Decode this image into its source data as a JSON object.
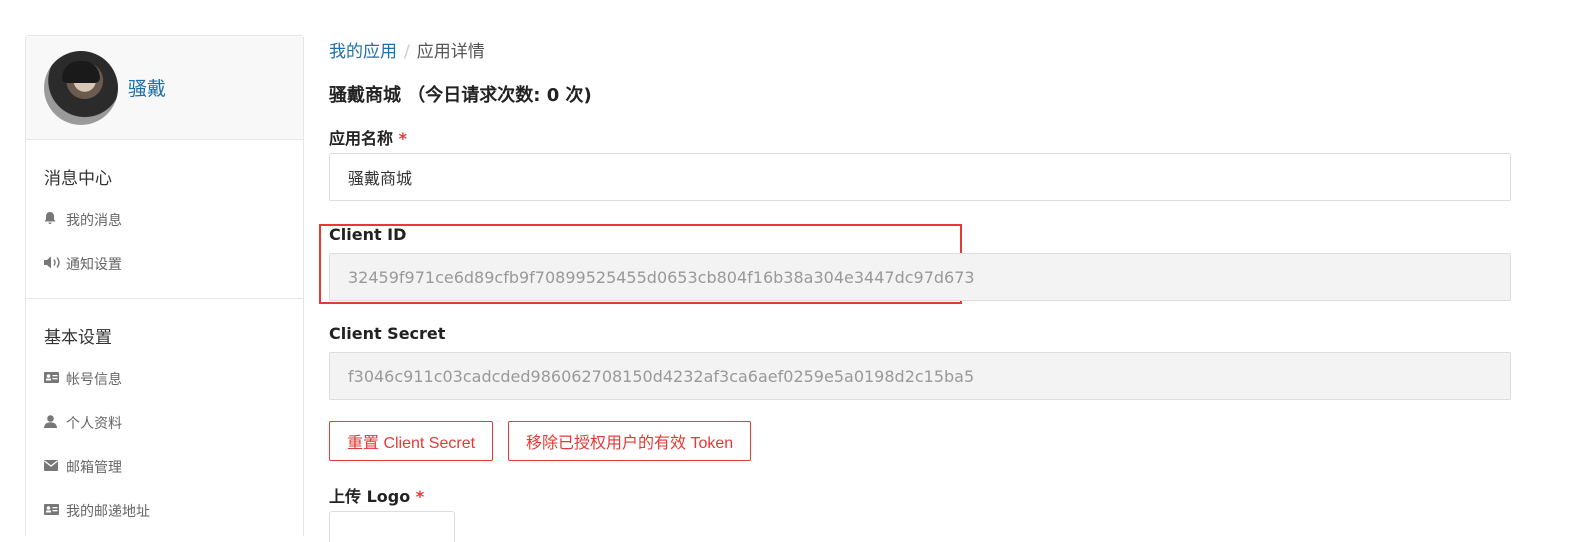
{
  "sidebar": {
    "username": "骚戴",
    "groups": [
      {
        "title": "消息中心",
        "items": [
          {
            "label": "我的消息",
            "icon": "bell-icon"
          },
          {
            "label": "通知设置",
            "icon": "speaker-icon"
          }
        ]
      },
      {
        "title": "基本设置",
        "items": [
          {
            "label": "帐号信息",
            "icon": "id-card-icon"
          },
          {
            "label": "个人资料",
            "icon": "user-icon"
          },
          {
            "label": "邮箱管理",
            "icon": "envelope-icon"
          },
          {
            "label": "我的邮递地址",
            "icon": "id-card-icon"
          }
        ]
      }
    ]
  },
  "breadcrumb": {
    "parent": "我的应用",
    "separator": "/",
    "current": "应用详情"
  },
  "app_title": "骚戴商城 （今日请求次数: 0 次)",
  "form": {
    "app_name_label": "应用名称",
    "required_mark": "*",
    "app_name_value": "骚戴商城",
    "client_id_label": "Client ID",
    "client_id_value": "32459f971ce6d89cfb9f70899525455d0653cb804f16b38a304e3447dc97d673",
    "client_secret_label": "Client Secret",
    "client_secret_value": "f3046c911c03cadcded986062708150d4232af3ca6aef0259e5a0198d2c15ba5",
    "reset_button": "重置 Client Secret",
    "revoke_button": "移除已授权用户的有效 Token",
    "upload_logo_label": "上传 Logo"
  },
  "colors": {
    "link": "#1f6fa8",
    "accent": "#e53935",
    "readonly_bg": "#f3f3f3"
  }
}
